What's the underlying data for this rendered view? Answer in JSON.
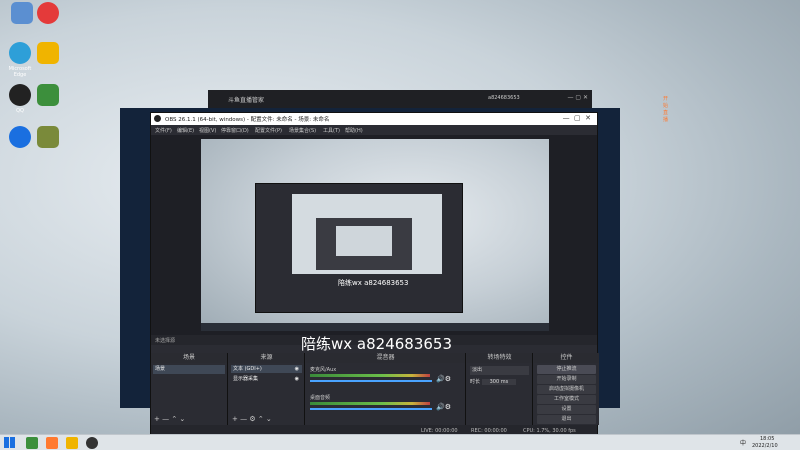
{
  "desktop": {
    "icons": [
      {
        "label": "",
        "color": "#3a7bd5"
      },
      {
        "label": "",
        "color": "#e43a3a"
      },
      {
        "label": "Microsoft Edge",
        "color": "#2e9fd8"
      },
      {
        "label": "",
        "color": "#f0b400"
      },
      {
        "label": "QQ",
        "color": "#222"
      },
      {
        "label": "",
        "color": "#3c8f3c"
      },
      {
        "label": "",
        "color": "#1a6fe0"
      },
      {
        "label": "",
        "color": "#7a8a3a"
      }
    ]
  },
  "back_window": {
    "title": "斗鱼直播管家",
    "user": "a824683653",
    "start_label": "开始直播"
  },
  "obs": {
    "title": "OBS 26.1.1 (64-bit, windows) - 配置文件: 未命名 - 场景: 未命名",
    "menu": [
      "文件(F)",
      "编辑(E)",
      "视图(V)",
      "停靠窗口(D)",
      "配置文件(P)",
      "场景集合(S)",
      "工具(T)",
      "帮助(H)"
    ],
    "source_bar_label": "未选择源",
    "overlay_text": "陪练wx a824683653",
    "docks": {
      "scenes": {
        "title": "场景",
        "items": [
          "场景"
        ]
      },
      "sources": {
        "title": "来源",
        "items": [
          "文本 (GDI+)",
          "显示器采集"
        ]
      },
      "mixer": {
        "title": "混音器",
        "channels": [
          {
            "name": "麦克风/Aux",
            "level": 0.85
          },
          {
            "name": "桌面音频",
            "level": 0.85
          }
        ]
      },
      "transitions": {
        "title": "转场特效",
        "type": "淡出",
        "duration_label": "时长",
        "duration": "300 ms"
      },
      "controls": {
        "title": "控件",
        "buttons": [
          "停止推流",
          "开始录制",
          "启动虚拟摄像机",
          "工作室模式",
          "设置",
          "退出"
        ]
      }
    },
    "status": {
      "live": "LIVE: 00:00:00",
      "rec": "REC: 00:00:00",
      "cpu": "CPU: 1.7%, 30.00 fps"
    }
  },
  "taskbar": {
    "time": "18:05",
    "date": "2022/2/10",
    "input": "中"
  },
  "colors": {
    "obs_bg": "#2b2c33",
    "obs_dark": "#1e1f25",
    "accent": "#4aa3ff"
  }
}
